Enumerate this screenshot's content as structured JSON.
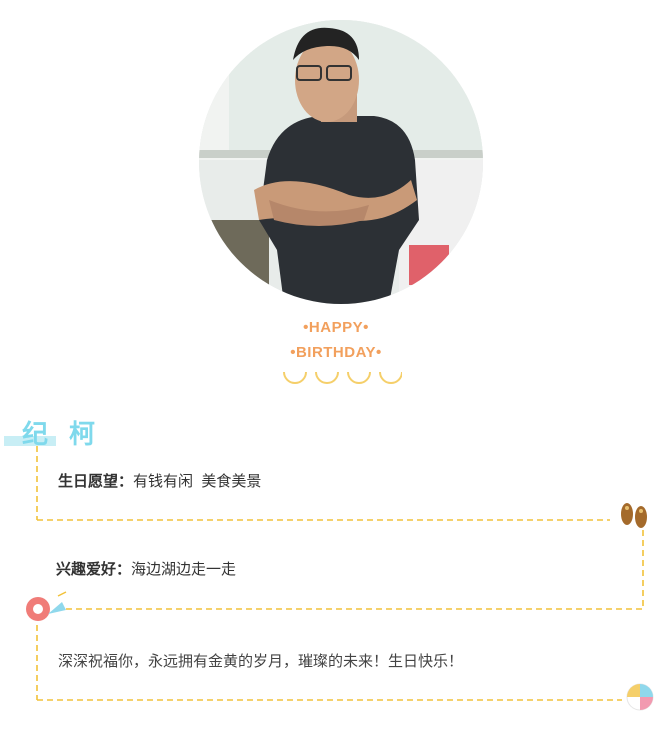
{
  "greeting": {
    "line1": "•HAPPY•",
    "line2": "•BIRTHDAY•"
  },
  "profile": {
    "name": "纪 柯"
  },
  "info": {
    "wish_label": "生日愿望：",
    "wish_value": "有钱有闲  美食美景",
    "hobby_label": "兴趣爱好：",
    "hobby_value": "海边湖边走一走",
    "blessing": "深深祝福你，永远拥有金黄的岁月，璀璨的未来！生日快乐！"
  },
  "colors": {
    "accent_orange": "#f2a05d",
    "dash_yellow": "#f2c23a",
    "name_cyan": "#7fd9ec",
    "name_bar": "#c8eef5"
  },
  "icons": {
    "slippers": "flip-flops-icon",
    "swim_ring": "swim-ring-icon",
    "beach_ball": "beach-ball-icon"
  }
}
